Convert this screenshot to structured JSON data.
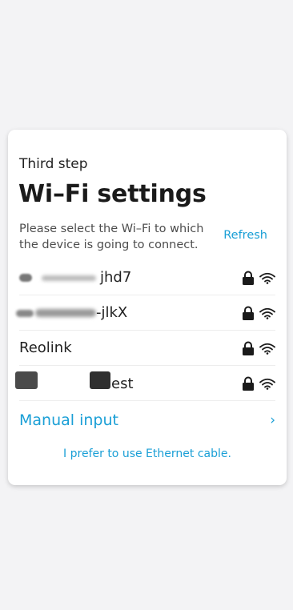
{
  "card": {
    "step": "Third step",
    "title": "Wi–Fi settings",
    "description": "Please select the Wi–Fi to which the device is going to connect.",
    "refresh_label": "Refresh"
  },
  "networks": [
    {
      "ssid": "jhd7",
      "secured": true,
      "signal_icon": "wifi-icon"
    },
    {
      "ssid": "-jlkX",
      "secured": true,
      "signal_icon": "wifi-icon"
    },
    {
      "ssid": "Reolink",
      "secured": true,
      "signal_icon": "wifi-icon"
    },
    {
      "ssid": "est",
      "secured": true,
      "signal_icon": "wifi-icon"
    }
  ],
  "manual_input": {
    "label": "Manual input",
    "chevron": "›"
  },
  "ethernet_link": "I prefer to use Ethernet cable.",
  "colors": {
    "accent": "#1a9fd6",
    "background": "#f3f3f5",
    "card": "#ffffff"
  },
  "icons": {
    "lock": "lock-icon",
    "wifi": "wifi-icon",
    "chevron": "chevron-right-icon"
  }
}
